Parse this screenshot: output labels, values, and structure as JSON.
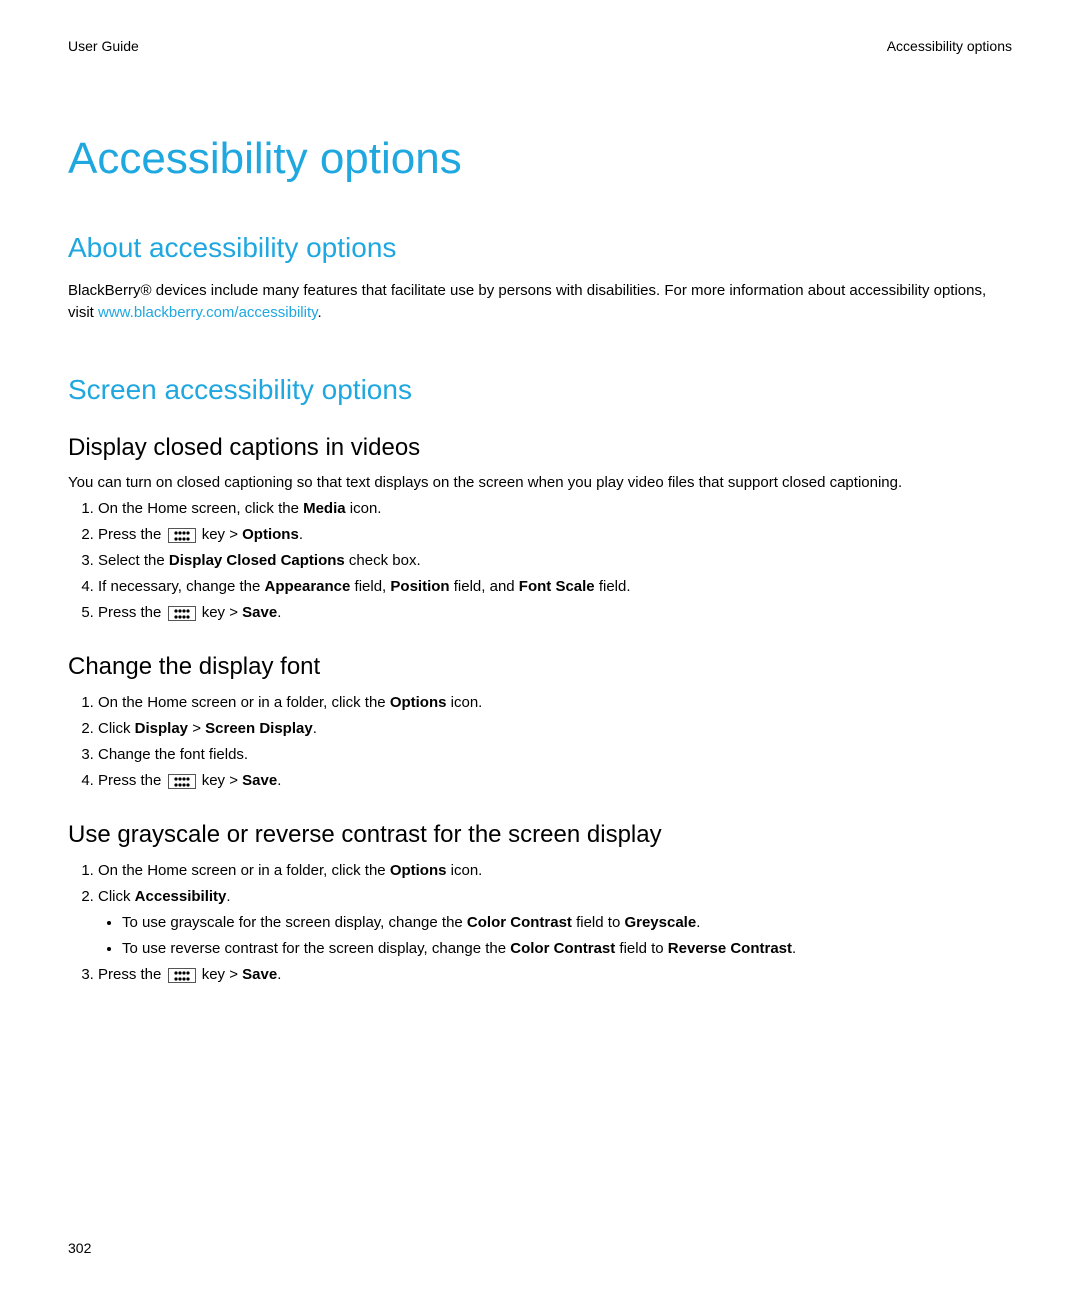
{
  "header": {
    "left": "User Guide",
    "right": "Accessibility options"
  },
  "page_title": "Accessibility options",
  "about": {
    "heading": "About accessibility options",
    "text_pre": "BlackBerry® devices include many features that facilitate use by persons with disabilities. For more information about accessibility options, visit ",
    "link": "www.blackberry.com/accessibility",
    "text_post": "."
  },
  "screen": {
    "heading": "Screen accessibility options",
    "captions": {
      "heading": "Display closed captions in videos",
      "intro": "You can turn on closed captioning so that text displays on the screen when you play video files that support closed captioning.",
      "step1_pre": "On the Home screen, click the ",
      "step1_b": "Media",
      "step1_post": " icon.",
      "step2_pre": "Press the ",
      "step2_mid": " key > ",
      "step2_b": "Options",
      "step2_post": ".",
      "step3_pre": "Select the ",
      "step3_b": "Display Closed Captions",
      "step3_post": " check box.",
      "step4_pre": "If necessary, change the ",
      "step4_b1": "Appearance",
      "step4_mid1": " field, ",
      "step4_b2": "Position",
      "step4_mid2": " field, and ",
      "step4_b3": "Font Scale",
      "step4_post": " field.",
      "step5_pre": "Press the ",
      "step5_mid": " key > ",
      "step5_b": "Save",
      "step5_post": "."
    },
    "font": {
      "heading": "Change the display font",
      "step1_pre": "On the Home screen or in a folder, click the ",
      "step1_b": "Options",
      "step1_post": " icon.",
      "step2_pre": "Click ",
      "step2_b1": "Display",
      "step2_mid": " > ",
      "step2_b2": "Screen Display",
      "step2_post": ".",
      "step3": "Change the font fields.",
      "step4_pre": "Press the ",
      "step4_mid": " key > ",
      "step4_b": "Save",
      "step4_post": "."
    },
    "contrast": {
      "heading": "Use grayscale or reverse contrast for the screen display",
      "step1_pre": "On the Home screen or in a folder, click the ",
      "step1_b": "Options",
      "step1_post": " icon.",
      "step2_pre": "Click ",
      "step2_b": "Accessibility",
      "step2_post": ".",
      "bullet1_pre": "To use grayscale for the screen display, change the ",
      "bullet1_b1": "Color Contrast",
      "bullet1_mid": " field to ",
      "bullet1_b2": "Greyscale",
      "bullet1_post": ".",
      "bullet2_pre": "To use reverse contrast for the screen display, change the ",
      "bullet2_b1": "Color Contrast",
      "bullet2_mid": " field to ",
      "bullet2_b2": "Reverse Contrast",
      "bullet2_post": ".",
      "step3_pre": "Press the ",
      "step3_mid": " key > ",
      "step3_b": "Save",
      "step3_post": "."
    }
  },
  "page_number": "302"
}
